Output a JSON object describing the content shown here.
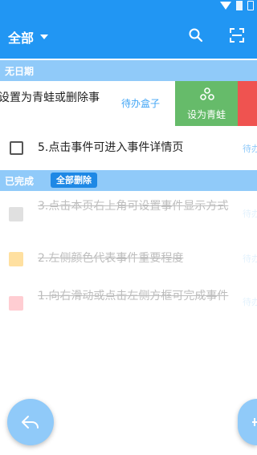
{
  "header": {
    "title": "全部",
    "bg_color": "#2196f3"
  },
  "icons": {
    "search": "search-icon",
    "scan": "scan-icon",
    "filter": "caret-down-icon"
  },
  "sections": {
    "no_date": "无日期",
    "completed": "已完成",
    "clear_all": "全部删除"
  },
  "swipe_row": {
    "text": "设置为青蛙或删除事",
    "tag": "待办盒子",
    "action_frog": "设为青蛙",
    "frog_color": "#66bb6a",
    "delete_color": "#ef5350"
  },
  "tasks": [
    {
      "text": "5.点击事件可进入事件详情页",
      "tag": "待办",
      "done": false
    }
  ],
  "completed_tasks": [
    {
      "text": "3.点击本页右上角可设置事件显示方式",
      "tag": "待办",
      "color": "#e0e0e0"
    },
    {
      "text": "2.左侧颜色代表事件重要程度",
      "tag": "待办",
      "color": "#ffe0a0"
    },
    {
      "text": "1.向右滑动或点击左侧方框可完成事件",
      "tag": "待办",
      "color": "#ffcdd2"
    }
  ]
}
